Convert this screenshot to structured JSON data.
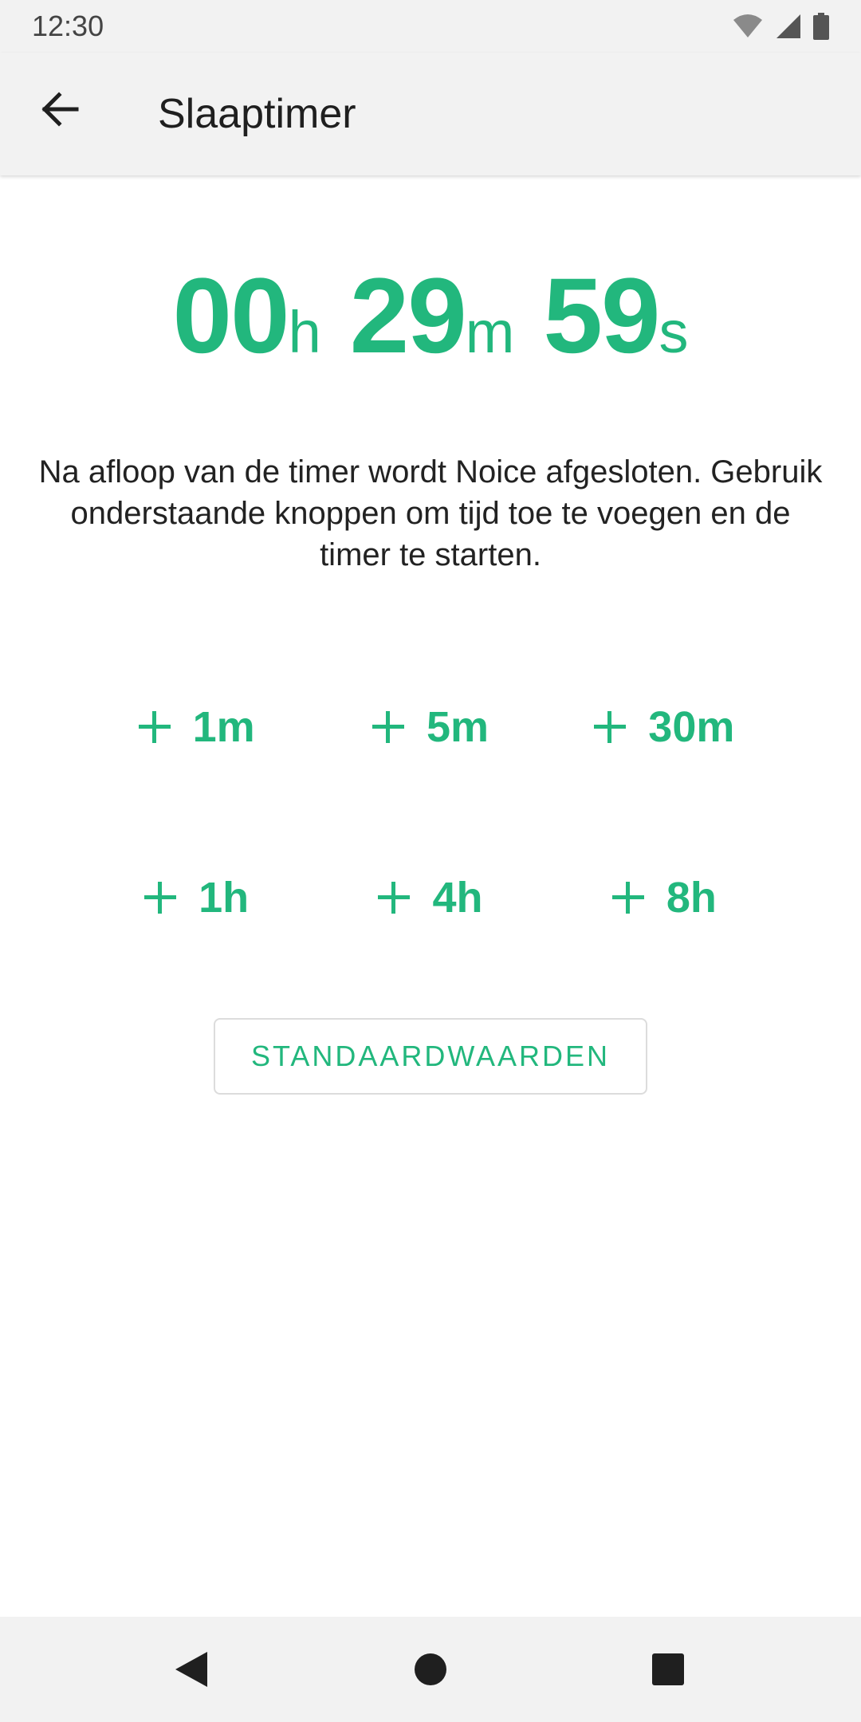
{
  "status_bar": {
    "time": "12:30",
    "icons": [
      "wifi-icon",
      "cellular-signal-icon",
      "battery-icon"
    ]
  },
  "app_bar": {
    "title": "Slaaptimer",
    "back_icon": "arrow-left-icon"
  },
  "timer": {
    "hours": "00",
    "hours_unit": "h",
    "minutes": "29",
    "minutes_unit": "m",
    "seconds": "59",
    "seconds_unit": "s"
  },
  "description": "Na afloop van de timer wordt Noice afgesloten. Gebruik onderstaande knoppen om tijd toe te voegen en de timer te starten.",
  "add_buttons": [
    {
      "label": "1m"
    },
    {
      "label": "5m"
    },
    {
      "label": "30m"
    },
    {
      "label": "1h"
    },
    {
      "label": "4h"
    },
    {
      "label": "8h"
    }
  ],
  "defaults_button": "STANDAARDWAARDEN",
  "nav_bar": {
    "icons": [
      "back-triangle-icon",
      "home-circle-icon",
      "recents-square-icon"
    ]
  },
  "colors": {
    "accent": "#22b77d",
    "bar_background": "#f2f2f2",
    "background": "#ffffff"
  }
}
